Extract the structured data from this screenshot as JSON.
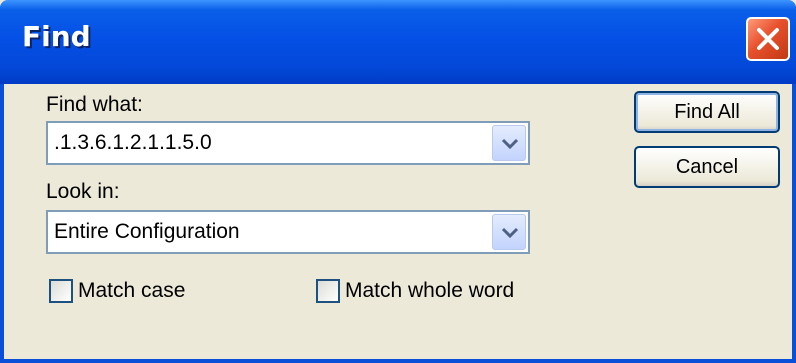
{
  "window": {
    "title": "Find"
  },
  "find_what": {
    "label": "Find what:",
    "value": ".1.3.6.1.2.1.1.5.0"
  },
  "look_in": {
    "label": "Look in:",
    "value": "Entire Configuration"
  },
  "options": {
    "match_case": "Match case",
    "match_whole_word": "Match whole word"
  },
  "buttons": {
    "find_all": "Find All",
    "cancel": "Cancel"
  },
  "icons": {
    "close": "close-icon",
    "dropdown": "chevron-down-icon"
  },
  "colors": {
    "titlebar": "#0550e6",
    "close": "#e7502c",
    "face": "#ece9d8"
  }
}
